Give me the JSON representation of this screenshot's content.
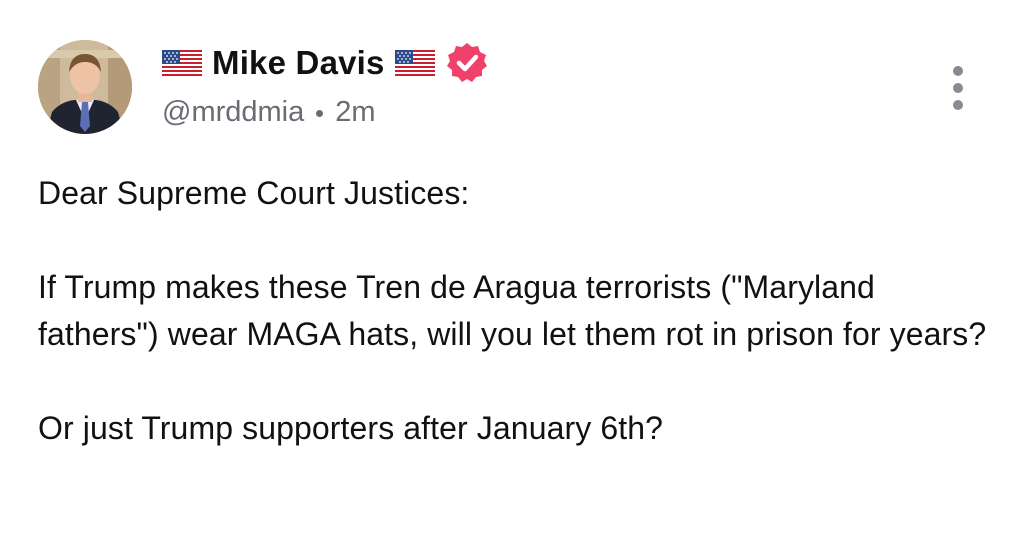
{
  "post": {
    "author": {
      "display_name": "Mike Davis",
      "flag_left_icon": "us-flag-icon",
      "flag_right_icon": "us-flag-icon",
      "verified_icon": "verified-badge-icon",
      "handle": "@mrddmia",
      "timestamp": "2m"
    },
    "more_icon": "more-vertical-icon",
    "paragraphs": [
      "Dear Supreme Court Justices:",
      "If Trump makes these Tren de Aragua terrorists (\"Maryland fathers\") wear MAGA hats, will you let them rot in prison for years?",
      "Or just Trump supporters after January 6th?"
    ]
  },
  "colors": {
    "verified_badge": "#f0416a",
    "meta_text": "#6b6b74",
    "body_text": "#111111"
  }
}
